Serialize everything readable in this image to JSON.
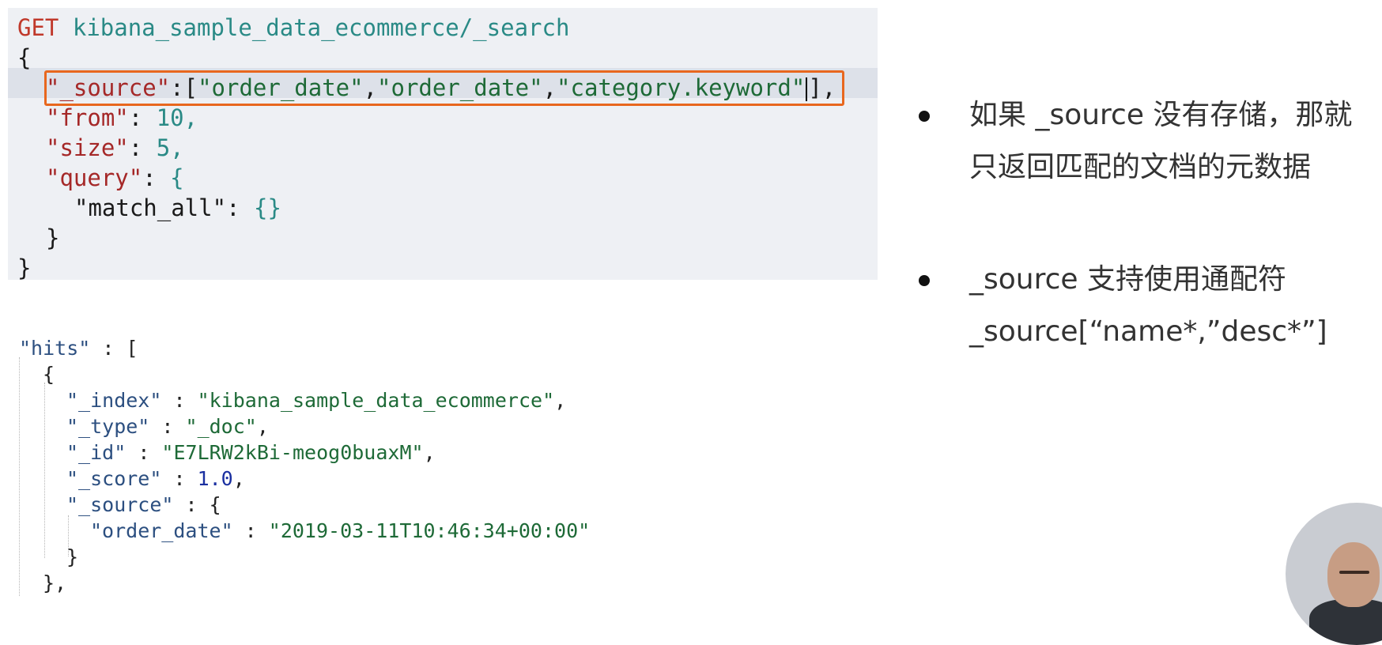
{
  "request": {
    "method": "GET",
    "path": "kibana_sample_data_ecommerce/_search",
    "open_brace": "{",
    "source_key": "\"_source\"",
    "source_values": [
      "\"order_date\"",
      "\"order_date\"",
      "\"category.keyword\""
    ],
    "from_key": "\"from\"",
    "from_value": "10",
    "size_key": "\"size\"",
    "size_value": "5",
    "query_key": "\"query\"",
    "match_all_key": "\"match_all\"",
    "match_all_value": "{}",
    "inner_close": "}",
    "close_brace": "}"
  },
  "response": {
    "hits_key": "\"hits\"",
    "hits_open": " : [",
    "obj_open": "{",
    "fields": [
      {
        "key": "\"_index\"",
        "value": "\"kibana_sample_data_ecommerce\"",
        "type": "string"
      },
      {
        "key": "\"_type\"",
        "value": "\"_doc\"",
        "type": "string"
      },
      {
        "key": "\"_id\"",
        "value": "\"E7LRW2kBi-meog0buaxM\"",
        "type": "string"
      },
      {
        "key": "\"_score\"",
        "value": "1.0",
        "type": "number"
      }
    ],
    "source_key": "\"_source\"",
    "source_open": " : {",
    "order_date_key": "\"order_date\"",
    "order_date_value": "\"2019-03-11T10:46:34+00:00\"",
    "source_close": "}",
    "obj_close": "},"
  },
  "notes": [
    {
      "lines": [
        "如果 _source 没有存储，那就",
        "只返回匹配的文档的元数据"
      ]
    },
    {
      "lines": [
        "_source 支持使用通配符",
        "_source[“name*,”desc*”]"
      ]
    }
  ],
  "colors": {
    "highlight_box": "#e8671e",
    "method": "#c0392b",
    "path": "#2a8a86",
    "json_key": "#a52828",
    "json_string": "#1e6a37",
    "response_key": "#2c4f80"
  }
}
